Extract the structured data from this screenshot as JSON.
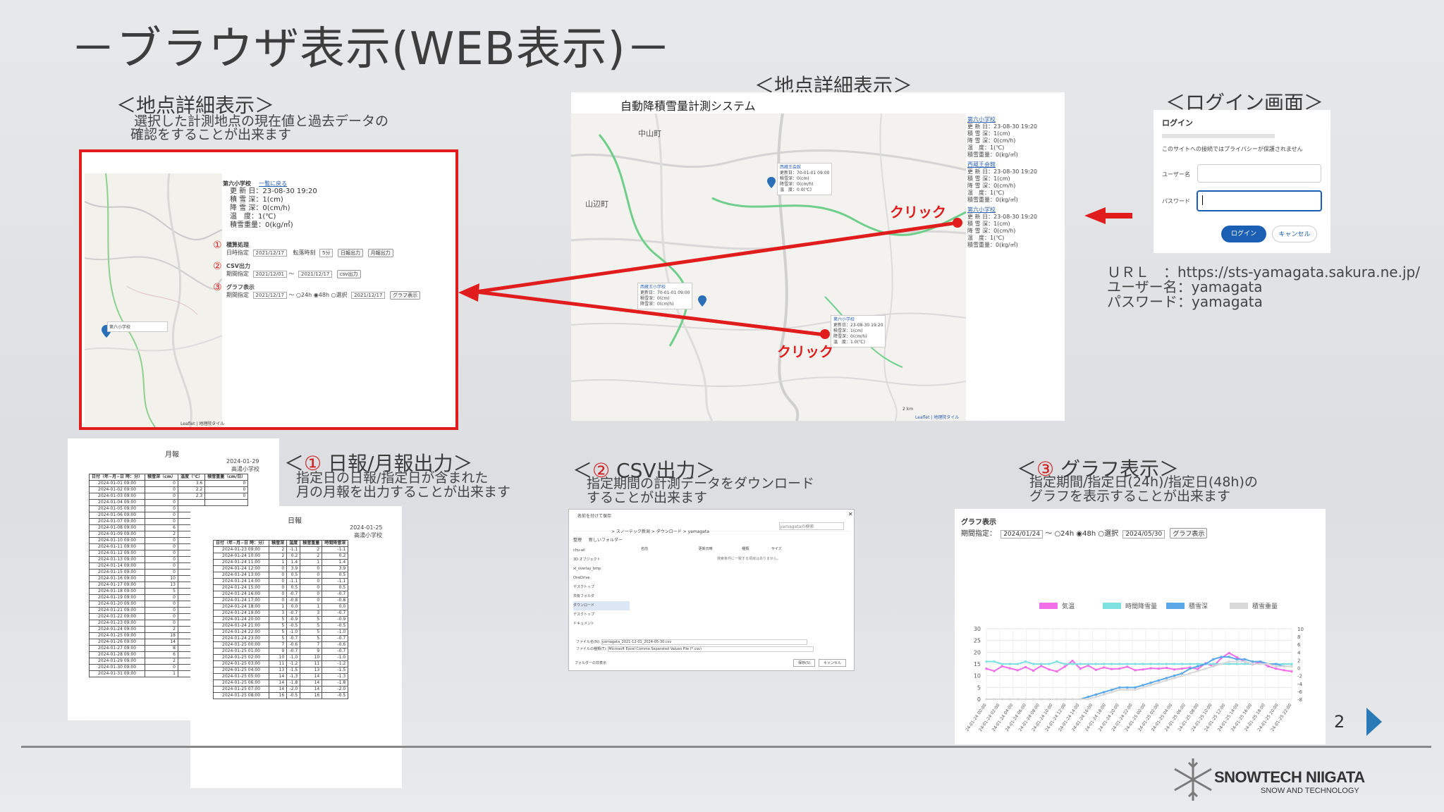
{
  "page_title": "－ブラウザ表示(WEB表示)－",
  "section_detail": {
    "title": "＜地点詳細表示＞",
    "desc1": "選択した計測地点の現在値と過去データの",
    "desc2": "確認をすることが出来ます"
  },
  "detail_panel": {
    "station": "第六小学校",
    "back_link": "一覧に戻る",
    "lines": [
      "更 新 日：23-08-30 19:20",
      "積 雪 深：1(cm)",
      "降 雪 深：0(cm/h)",
      "温　度：1(℃)",
      "積雪重量：0(kg/㎡)"
    ],
    "s1_title": "積算処理",
    "s1_label": "日時指定",
    "s1_date": "2021/12/17",
    "s1_interval_label": "転落時刻",
    "s1_interval": "5分",
    "s1_btn1": "日報出力",
    "s1_btn2": "月報出力",
    "s2_title": "CSV出力",
    "s2_label": "期間指定",
    "s2_from": "2021/12/01",
    "s2_to": "2021/12/17",
    "s2_btn": "csv出力",
    "s3_title": "グラフ表示",
    "s3_label": "期間指定",
    "s3_date": "2021/12/17",
    "s3_opt1": "24h",
    "s3_opt2": "48h",
    "s3_opt3": "選択",
    "s3_to": "2021/12/17",
    "s3_btn": "グラフ表示",
    "mini_popup_title": "第六小学校",
    "map_attr": "Leaflet | 地理院タイル"
  },
  "section_detail2": {
    "title": "＜地点詳細表示＞"
  },
  "map_panel": {
    "system_title": "自動降積雪量計測システム",
    "town1": "中山町",
    "town2": "山辺町",
    "pins": [
      {
        "name": "西蔵王会館",
        "lines": [
          "更新日：70-01-01 09:00",
          "積雪深：0(cm)",
          "降雪深：0(cm/h)",
          "温　度：0.0(℃)"
        ]
      },
      {
        "name": "西蔵王小学校",
        "lines": [
          "更新日：70-01-01 09:00",
          "積雪深：0(cm)",
          "降雪深：0(cm/h)"
        ]
      },
      {
        "name": "第六小学校",
        "lines": [
          "更新日：23-08-30 19:20",
          "積雪深：1(cm)",
          "降雪深：0(cm/h)",
          "温　度：1.0(℃)"
        ]
      }
    ],
    "list": [
      {
        "name": "第六小学校",
        "lines": [
          "更 新 日：23-08-30 19:20",
          "積 雪 深：1(cm)",
          "降 雪 深：0(cm/h)",
          "温　度：1(℃)",
          "積雪重量：0(kg/㎡)"
        ]
      },
      {
        "name": "西蔵王会館",
        "lines": [
          "更 新 日：23-08-30 19:20",
          "積 雪 深：1(cm)",
          "降 雪 深：0(cm/h)",
          "温　度：1(℃)",
          "積雪重量：0(kg/㎡)"
        ]
      },
      {
        "name": "第六小学校",
        "lines": [
          "更 新 日：23-08-30 19:20",
          "積 雪 深：1(cm)",
          "降 雪 深：0(cm/h)",
          "温　度：1(℃)",
          "積雪重量：0(kg/㎡)"
        ]
      }
    ],
    "click1": "クリック",
    "click2": "クリック",
    "scale": "2 km",
    "attr": "Leaflet | 地理院タイル"
  },
  "login": {
    "title": "＜ログイン画面＞",
    "dialog_title": "ログイン",
    "notice": "このサイトへの接続ではプライバシーが保護されません",
    "user_label": "ユーザー名",
    "pass_label": "パスワード",
    "login_btn": "ログイン",
    "cancel_btn": "キャンセル",
    "url_label": "ＵＲＬ　：",
    "url": "https://sts-yamagata.sakura.ne.jp/",
    "user_line_label": "ユーザー名：",
    "user_value": "yamagata",
    "pass_line_label": "パスワード：",
    "pass_value": "yamagata"
  },
  "report": {
    "title_prefix": "＜",
    "num": "①",
    "title": " 日報/月報出力＞",
    "desc1": "指定日の日報/指定日が含まれた",
    "desc2": "月の月報を出力することが出来ます",
    "monthly": {
      "title": "月報",
      "date": "2024-01-29",
      "school": "高湯小学校",
      "headers": [
        "日付（年−月−日 時：分）",
        "積雪深（cm）",
        "温度（℃）",
        "積雪重量（cm/日）"
      ],
      "rows": [
        [
          "2024-01-01 09:00",
          "0",
          "3.6",
          "0"
        ],
        [
          "2024-01-02 09:00",
          "0",
          "2.2",
          "0"
        ],
        [
          "2024-01-03 09:00",
          "0",
          "2.3",
          "0"
        ],
        [
          "2024-01-04 09:00",
          "0",
          "",
          ""
        ],
        [
          "2024-01-05 09:00",
          "0",
          "",
          ""
        ],
        [
          "2024-01-06 09:00",
          "0",
          "",
          ""
        ],
        [
          "2024-01-07 09:00",
          "0",
          "",
          ""
        ],
        [
          "2024-01-08 09:00",
          "6",
          "",
          ""
        ],
        [
          "2024-01-09 09:00",
          "2",
          "",
          ""
        ],
        [
          "2024-01-10 09:00",
          "0",
          "",
          ""
        ],
        [
          "2024-01-11 09:00",
          "0",
          "",
          ""
        ],
        [
          "2024-01-12 09:00",
          "0",
          "",
          ""
        ],
        [
          "2024-01-13 09:00",
          "0",
          "",
          ""
        ],
        [
          "2024-01-14 09:00",
          "0",
          "",
          ""
        ],
        [
          "2024-01-15 09:00",
          "0",
          "",
          ""
        ],
        [
          "2024-01-16 09:00",
          "10",
          "",
          ""
        ],
        [
          "2024-01-17 09:00",
          "13",
          "",
          ""
        ],
        [
          "2024-01-18 09:00",
          "5",
          "",
          ""
        ],
        [
          "2024-01-19 09:00",
          "0",
          "",
          ""
        ],
        [
          "2024-01-20 09:00",
          "0",
          "",
          ""
        ],
        [
          "2024-01-21 09:00",
          "0",
          "",
          ""
        ],
        [
          "2024-01-22 09:00",
          "0",
          "",
          ""
        ],
        [
          "2024-01-23 09:00",
          "0",
          "",
          ""
        ],
        [
          "2024-01-24 09:00",
          "2",
          "",
          ""
        ],
        [
          "2024-01-25 09:00",
          "18",
          "",
          ""
        ],
        [
          "2024-01-26 09:00",
          "14",
          "",
          ""
        ],
        [
          "2024-01-27 09:00",
          "8",
          "",
          ""
        ],
        [
          "2024-01-28 09:00",
          "6",
          "",
          ""
        ],
        [
          "2024-01-29 09:00",
          "2",
          "",
          ""
        ],
        [
          "2024-01-30 09:00",
          "0",
          "",
          ""
        ],
        [
          "2024-01-31 09:00",
          "1",
          "",
          ""
        ]
      ]
    },
    "daily": {
      "title": "日報",
      "date": "2024-01-25",
      "school": "高湯小学校",
      "headers": [
        "日付（年−月−日 時：分）",
        "積雪深",
        "温度",
        "積雪重量",
        "時間降雪深"
      ],
      "rows": [
        [
          "2024-01-23 09:00",
          "2",
          "-1.1",
          "2",
          "-1.1"
        ],
        [
          "2024-01-24 10:00",
          "2",
          "0.2",
          "2",
          "0.2"
        ],
        [
          "2024-01-24 11:00",
          "1",
          "1.4",
          "1",
          "1.4"
        ],
        [
          "2024-01-24 12:00",
          "0",
          "3.9",
          "0",
          "3.9"
        ],
        [
          "2024-01-24 13:00",
          "0",
          "0.5",
          "0",
          "0.5"
        ],
        [
          "2024-01-24 14:00",
          "0",
          "-1.1",
          "0",
          "-1.1"
        ],
        [
          "2024-01-24 15:00",
          "0",
          "0.5",
          "0",
          "0.5"
        ],
        [
          "2024-01-24 16:00",
          "0",
          "-0.7",
          "0",
          "-0.7"
        ],
        [
          "2024-01-24 17:00",
          "0",
          "-0.8",
          "0",
          "-0.8"
        ],
        [
          "2024-01-24 18:00",
          "1",
          "0.0",
          "1",
          "0.0"
        ],
        [
          "2024-01-24 19:00",
          "3",
          "-0.7",
          "3",
          "-0.7"
        ],
        [
          "2024-01-24 20:00",
          "5",
          "-0.9",
          "5",
          "-0.9"
        ],
        [
          "2024-01-24 21:00",
          "5",
          "-0.5",
          "5",
          "-0.5"
        ],
        [
          "2024-01-24 22:00",
          "5",
          "-1.0",
          "5",
          "-1.0"
        ],
        [
          "2024-01-24 23:00",
          "5",
          "-0.7",
          "5",
          "-0.7"
        ],
        [
          "2024-01-25 00:00",
          "7",
          "-0.6",
          "7",
          "-0.6"
        ],
        [
          "2024-01-25 01:00",
          "9",
          "-0.7",
          "9",
          "-0.7"
        ],
        [
          "2024-01-25 02:00",
          "10",
          "-1.0",
          "10",
          "-1.0"
        ],
        [
          "2024-01-25 03:00",
          "11",
          "-1.2",
          "11",
          "-1.2"
        ],
        [
          "2024-01-25 04:00",
          "13",
          "-1.5",
          "13",
          "-1.5"
        ],
        [
          "2024-01-25 05:00",
          "14",
          "-1.3",
          "14",
          "-1.3"
        ],
        [
          "2024-01-25 06:00",
          "14",
          "-1.8",
          "14",
          "-1.8"
        ],
        [
          "2024-01-25 07:00",
          "14",
          "-2.0",
          "14",
          "-2.0"
        ],
        [
          "2024-01-25 08:00",
          "16",
          "-0.5",
          "16",
          "-0.5"
        ]
      ]
    }
  },
  "csv": {
    "title_prefix": "＜",
    "num": "②",
    "title": " CSV出力＞",
    "desc1": "指定期間の計測データをダウンロード",
    "desc2": "することが出来ます",
    "dialog_title": "名前を付けて保存",
    "breadcrumb": "> スノーテック新潟 > ダウンロード > yamagata",
    "search_ph": "yamagataの検索",
    "organize": "整理",
    "new_folder": "新しいフォルダー",
    "sidebar": [
      "chu-all",
      "3D オブジェクト",
      "xl_overlay_bmp",
      "OneDrive",
      "デスクトップ",
      "共有フォルダ",
      "ダウンロード",
      "デスクトップ",
      "ドキュメント"
    ],
    "cols": [
      "名前",
      "更新日時",
      "種類",
      "サイズ"
    ],
    "empty": "検索条件に一致する項目はありません。",
    "filename_label": "ファイル名(N):",
    "filename": "yamagata_2021-12-01_2024-05-30.csv",
    "filetype_label": "ファイルの種類(T):",
    "filetype": "Microsoft Excel Comma Separated Values File (*.csv)",
    "hide_folders": "フォルダーの非表示",
    "save_btn": "保存(S)",
    "cancel_btn": "キャンセル"
  },
  "graph": {
    "title_prefix": "＜",
    "num": "③",
    "title": " グラフ表示＞",
    "desc1": "指定期間/指定日(24h)/指定日(48h)の",
    "desc2": "グラフを表示することが出来ます",
    "panel_title": "グラフ表示",
    "period_label": "期間指定：",
    "from": "2024/01/24",
    "tilde": "〜",
    "opt1": "24h",
    "opt2": "48h",
    "opt3": "選択",
    "to": "2024/05/30",
    "btn": "グラフ表示"
  },
  "chart_data": {
    "type": "line",
    "legend": [
      "気温",
      "時間降雪量",
      "積雪深",
      "積雪重量"
    ],
    "legend_colors": [
      "#f06ee8",
      "#7fe0e0",
      "#5aa8e8",
      "#d8d8d8"
    ],
    "y_left_ticks": [
      0,
      5,
      10,
      15,
      20,
      25,
      30
    ],
    "y_right_ticks": [
      -8,
      -6,
      -4,
      -2,
      0,
      2,
      4,
      6,
      8,
      10
    ],
    "x_ticks": [
      "24-01-24 00:00",
      "24-01-24 02:00",
      "24-01-24 04:00",
      "24-01-24 06:00",
      "24-01-24 08:00",
      "24-01-24 10:00",
      "24-01-24 12:00",
      "24-01-24 14:00",
      "24-01-24 16:00",
      "24-01-24 18:00",
      "24-01-24 20:00",
      "24-01-24 22:00",
      "24-01-25 00:00",
      "24-01-25 02:00",
      "24-01-25 04:00",
      "24-01-25 06:00",
      "24-01-25 08:00",
      "24-01-25 10:00",
      "24-01-25 12:00",
      "24-01-25 14:00",
      "24-01-25 16:00",
      "24-01-25 18:00",
      "24-01-25 20:00",
      "24-01-25 22:00"
    ],
    "series": [
      {
        "name": "気温",
        "axis": "right",
        "values": [
          -0.2,
          -0.8,
          0.4,
          -0.1,
          -0.6,
          0.2,
          -0.7,
          0.5,
          -0.4,
          -0.9,
          0.3,
          1.8,
          -0.2,
          0.6,
          -0.5,
          0.1,
          -0.3,
          -0.2,
          0.3,
          -0.6,
          -0.4,
          -0.1,
          -0.2,
          0.0,
          -0.4,
          -0.2,
          0.1,
          -0.3,
          1.2,
          0.4,
          2.5,
          3.8,
          2.7,
          1.6,
          0.9,
          1.5,
          0.4,
          -0.2,
          -0.6,
          -0.9
        ]
      },
      {
        "name": "時間降雪量",
        "axis": "left",
        "values": [
          16,
          16,
          15,
          15,
          15,
          16,
          15,
          15,
          15,
          16,
          15,
          15,
          15,
          15,
          15,
          15,
          15,
          15,
          15,
          15,
          15,
          15,
          15,
          15,
          15,
          15,
          15,
          15,
          15,
          15,
          15,
          15,
          15,
          15,
          15,
          15,
          15,
          15,
          15,
          15
        ]
      },
      {
        "name": "積雪深",
        "axis": "left",
        "values": [
          0,
          0,
          0,
          0,
          0,
          0,
          0,
          0,
          0,
          0,
          0,
          0,
          0,
          1,
          2,
          3,
          4,
          5,
          5,
          5,
          6,
          7,
          8,
          9,
          10,
          11,
          13,
          14,
          15,
          17,
          18,
          18,
          17,
          17,
          16,
          16,
          15,
          15,
          14,
          14
        ]
      },
      {
        "name": "積雪重量",
        "axis": "left",
        "values": [
          0,
          0,
          0,
          0,
          0,
          0,
          0,
          0,
          0,
          0,
          0,
          0,
          0,
          0,
          1,
          2,
          3,
          4,
          4,
          4,
          5,
          6,
          7,
          8,
          9,
          10,
          11,
          12,
          13,
          14,
          15,
          16,
          16,
          16,
          15,
          15,
          15,
          14,
          14,
          14
        ]
      }
    ],
    "ylim_left": [
      0,
      30
    ],
    "ylim_right": [
      -8,
      10
    ]
  },
  "footer": {
    "page_number": "2",
    "brand": "SNOWTECH NIIGATA",
    "tagline": "SNOW AND TECHNOLOGY"
  },
  "colors": {
    "accent_red": "#e01c1c",
    "login_blue": "#1a5fb4"
  }
}
